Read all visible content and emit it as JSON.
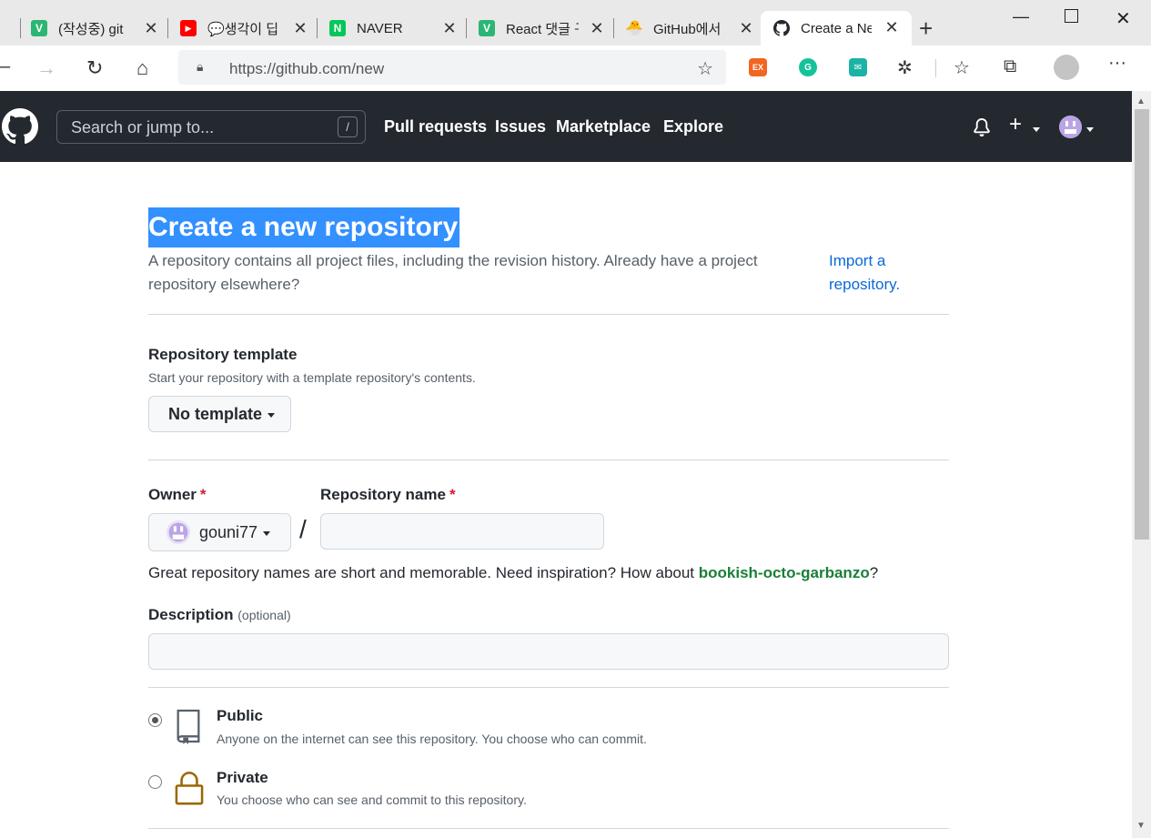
{
  "browser": {
    "tabs": [
      {
        "title": "(작성중) git",
        "icon_color": "#2bb673",
        "icon_glyph": "V"
      },
      {
        "title": "💬생각이 딥",
        "icon_color": "#ff0000",
        "icon_glyph": "▶"
      },
      {
        "title": "NAVER",
        "icon_color": "#03c75a",
        "icon_glyph": "N"
      },
      {
        "title": "React 댓글 구",
        "icon_color": "#2bb673",
        "icon_glyph": "V"
      },
      {
        "title": "GitHub에서",
        "icon_color": "#f5d76e",
        "icon_glyph": "🐣"
      },
      {
        "title": "Create a Ne",
        "icon_color": "#24292f",
        "icon_glyph": "●"
      }
    ],
    "address": {
      "scheme": "https://",
      "host": "github.com",
      "path": "/new"
    },
    "extensions": [
      {
        "name": "ex-extension",
        "label": "EX",
        "color": "#f26522"
      },
      {
        "name": "grammarly-extension",
        "label": "G",
        "color": "#15c39a"
      },
      {
        "name": "extension-teal",
        "label": "✉",
        "color": "#1ab3a6"
      }
    ]
  },
  "header": {
    "search_placeholder": "Search or jump to...",
    "search_key": "/",
    "nav": [
      "Pull requests",
      "Issues",
      "Marketplace",
      "Explore"
    ]
  },
  "main": {
    "title": "Create a new repository",
    "lead": "A repository contains all project files, including the revision history. Already have a project repository elsewhere?",
    "import_link": "Import a repository.",
    "template": {
      "heading": "Repository template",
      "note": "Start your repository with a template repository's contents.",
      "button": "No template"
    },
    "owner": {
      "label": "Owner",
      "required": "*",
      "value": "gouni77"
    },
    "repo_name": {
      "label": "Repository name",
      "required": "*",
      "value": ""
    },
    "separator": "/",
    "suggestion": {
      "prefix": "Great repository names are short and memorable. Need inspiration? How about ",
      "name": "bookish-octo-garbanzo",
      "suffix": "?"
    },
    "description": {
      "label": "Description",
      "optional": "(optional)",
      "value": ""
    },
    "visibility": [
      {
        "title": "Public",
        "desc": "Anyone on the internet can see this repository. You choose who can commit.",
        "checked": true
      },
      {
        "title": "Private",
        "desc": "You choose who can see and commit to this repository.",
        "checked": false
      }
    ]
  }
}
